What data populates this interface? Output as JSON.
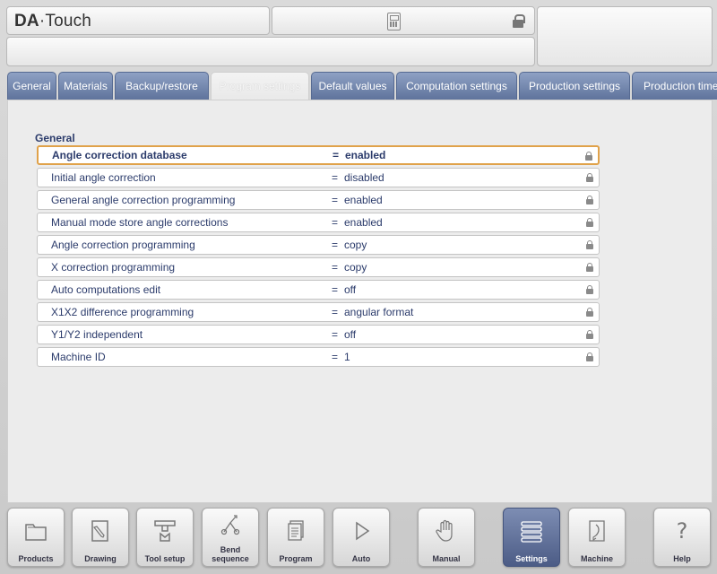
{
  "app": {
    "logo_brand": "DA",
    "logo_product": "Touch"
  },
  "header": {
    "center_icon": "calculator-icon",
    "lock_icon": "lock-icon"
  },
  "tabs": [
    {
      "label": "General",
      "active": false
    },
    {
      "label": "Materials",
      "active": false
    },
    {
      "label": "Backup/restore",
      "active": false
    },
    {
      "label": "Program settings",
      "active": true
    },
    {
      "label": "Default values",
      "active": false
    },
    {
      "label": "Computation settings",
      "active": false
    },
    {
      "label": "Production settings",
      "active": false
    },
    {
      "label": "Production time",
      "active": false
    }
  ],
  "section": {
    "title": "General"
  },
  "settings": [
    {
      "label": "Angle correction database",
      "eq": "=",
      "value": "enabled",
      "selected": true
    },
    {
      "label": "Initial angle correction",
      "eq": "=",
      "value": "disabled"
    },
    {
      "label": "General angle correction programming",
      "eq": "=",
      "value": "enabled"
    },
    {
      "label": "Manual mode store angle corrections",
      "eq": "=",
      "value": "enabled"
    },
    {
      "label": "Angle correction programming",
      "eq": "=",
      "value": "copy"
    },
    {
      "label": "X correction programming",
      "eq": "=",
      "value": "copy"
    },
    {
      "label": "Auto computations edit",
      "eq": "=",
      "value": "off"
    },
    {
      "label": "X1X2 difference programming",
      "eq": "=",
      "value": "angular format"
    },
    {
      "label": "Y1/Y2 independent",
      "eq": "=",
      "value": "off"
    },
    {
      "label": "Machine ID",
      "eq": "=",
      "value": "1"
    }
  ],
  "bottom_nav": [
    {
      "label": "Products",
      "icon": "folder-icon"
    },
    {
      "label": "Drawing",
      "icon": "pencil-icon"
    },
    {
      "label": "Tool setup",
      "icon": "press-tool-icon"
    },
    {
      "label": "Bend sequence",
      "label_line1": "Bend",
      "label_line2": "sequence",
      "icon": "bend-sequence-icon"
    },
    {
      "label": "Program",
      "icon": "document-stack-icon"
    },
    {
      "label": "Auto",
      "icon": "play-icon"
    },
    {
      "label": "Manual",
      "icon": "hand-icon"
    },
    {
      "label": "Settings",
      "icon": "settings-list-icon",
      "active": true
    },
    {
      "label": "Machine",
      "icon": "machine-icon"
    },
    {
      "label": "Help",
      "icon": "help-icon",
      "glyph": "?"
    }
  ],
  "colors": {
    "tab_bg": "#6f82aa",
    "selected_border": "#e0a24a",
    "label_text": "#2b3b6b",
    "active_nav": "#5a6a92"
  }
}
